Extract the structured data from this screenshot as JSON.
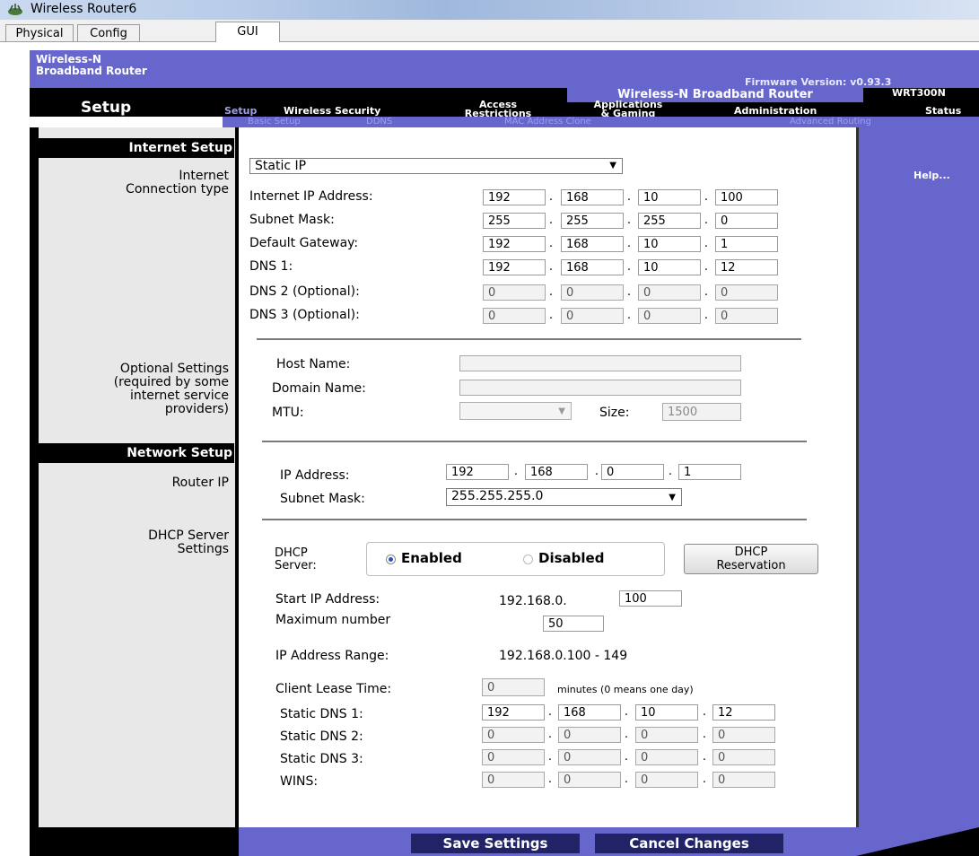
{
  "window": {
    "title": "Wireless Router6"
  },
  "tabs": [
    "Physical",
    "Config",
    "GUI"
  ],
  "header": {
    "brand_line1": "Wireless-N",
    "brand_line2": "Broadband Router",
    "firmware": "Firmware Version: v0.93.3",
    "product": "Wireless-N Broadband Router",
    "model": "WRT300N",
    "section": "Setup"
  },
  "nav": {
    "setup": "Setup",
    "wireless_security": "Wireless Security",
    "access_1": "Access",
    "access_2": "Restrictions",
    "apps_1": "Applications",
    "apps_2": "& Gaming",
    "administration": "Administration",
    "status": "Status"
  },
  "subnav": [
    "Basic Setup",
    "DDNS",
    "MAC Address Clone",
    "Advanced Routing"
  ],
  "left": {
    "internet_setup": "Internet Setup",
    "conn_type_1": "Internet",
    "conn_type_2": "Connection type",
    "optional_1": "Optional Settings",
    "optional_2": "(required by some",
    "optional_3": "internet service",
    "optional_4": "providers)",
    "network_setup": "Network Setup",
    "router_ip": "Router IP",
    "dhcp_1": "DHCP Server",
    "dhcp_2": "Settings"
  },
  "help": "Help...",
  "internet": {
    "conn_type": "Static IP",
    "ip_label": "Internet IP Address:",
    "ip": [
      "192",
      "168",
      "10",
      "100"
    ],
    "mask_label": "Subnet Mask:",
    "mask": [
      "255",
      "255",
      "255",
      "0"
    ],
    "gw_label": "Default Gateway:",
    "gw": [
      "192",
      "168",
      "10",
      "1"
    ],
    "dns1_label": "DNS 1:",
    "dns1": [
      "192",
      "168",
      "10",
      "12"
    ],
    "dns2_label": "DNS 2 (Optional):",
    "dns2": [
      "0",
      "0",
      "0",
      "0"
    ],
    "dns3_label": "DNS 3 (Optional):",
    "dns3": [
      "0",
      "0",
      "0",
      "0"
    ]
  },
  "optional": {
    "host_label": "Host Name:",
    "host": "",
    "domain_label": "Domain Name:",
    "domain": "",
    "mtu_label": "MTU:",
    "mtu": "",
    "size_label": "Size:",
    "size": "1500"
  },
  "router": {
    "ip_label": "IP Address:",
    "ip": [
      "192",
      "168",
      "0",
      "1"
    ],
    "mask_label": "Subnet Mask:",
    "mask": "255.255.255.0"
  },
  "dhcp": {
    "server_label_1": "DHCP",
    "server_label_2": "Server:",
    "enabled": "Enabled",
    "disabled": "Disabled",
    "reservation_1": "DHCP",
    "reservation_2": "Reservation",
    "start_label": "Start IP Address:",
    "start_prefix": "192.168.0.",
    "start": "100",
    "max_label": "Maximum number",
    "max": "50",
    "range_label": "IP Address Range:",
    "range": "192.168.0.100 - 149",
    "lease_label": "Client Lease Time:",
    "lease": "0",
    "lease_note": "minutes (0 means one day)",
    "sdns1_label": "Static DNS 1:",
    "sdns1": [
      "192",
      "168",
      "10",
      "12"
    ],
    "sdns2_label": "Static DNS 2:",
    "sdns2": [
      "0",
      "0",
      "0",
      "0"
    ],
    "sdns3_label": "Static DNS 3:",
    "sdns3": [
      "0",
      "0",
      "0",
      "0"
    ],
    "wins_label": "WINS:",
    "wins": [
      "0",
      "0",
      "0",
      "0"
    ]
  },
  "footer": {
    "save": "Save Settings",
    "cancel": "Cancel Changes"
  }
}
